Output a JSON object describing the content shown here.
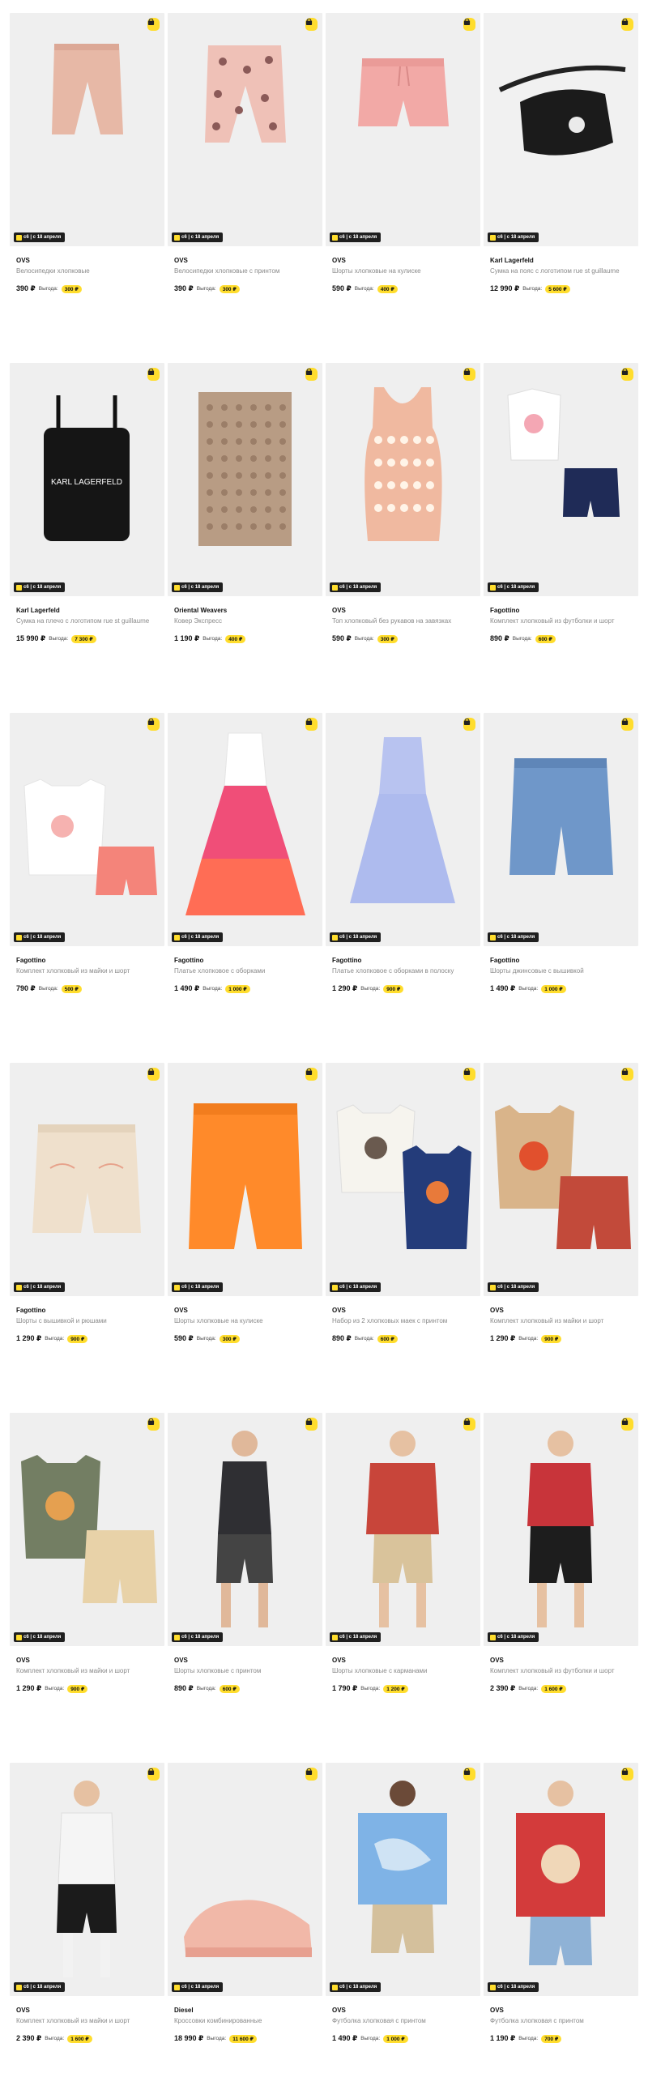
{
  "badge_text": "c6 | c 18 апреля",
  "save_label": "Выгода:",
  "products": [
    {
      "brand": "OVS",
      "title": "Велосипедки хлопковые",
      "price": "390 ₽",
      "save": "300 ₽",
      "bg": "#efefef",
      "art": "bike-shorts-pink"
    },
    {
      "brand": "OVS",
      "title": "Велосипедки хлопковые с принтом",
      "price": "390 ₽",
      "save": "300 ₽",
      "bg": "#efefef",
      "art": "bike-shorts-floral"
    },
    {
      "brand": "OVS",
      "title": "Шорты хлопковые на кулиске",
      "price": "590 ₽",
      "save": "400 ₽",
      "bg": "#efefef",
      "art": "shorts-pink"
    },
    {
      "brand": "Karl Lagerfeld",
      "title": "Сумка на пояс с логотипом rue st guillaume",
      "price": "12 990 ₽",
      "save": "5 600 ₽",
      "bg": "#f1f1f1",
      "art": "waist-bag"
    },
    {
      "brand": "Karl Lagerfeld",
      "title": "Сумка на плечо с логотипом rue st guillaume",
      "price": "15 990 ₽",
      "save": "7 300 ₽",
      "bg": "#efefef",
      "art": "shoulder-bag"
    },
    {
      "brand": "Oriental Weavers",
      "title": "Ковер Экспресс",
      "price": "1 190 ₽",
      "save": "400 ₽",
      "bg": "#efefef",
      "art": "rug"
    },
    {
      "brand": "OVS",
      "title": "Топ хлопковый без рукавов на завязках",
      "price": "590 ₽",
      "save": "300 ₽",
      "bg": "#efefef",
      "art": "top-floral"
    },
    {
      "brand": "Fagottino",
      "title": "Комплект хлопковый из футболки и шорт",
      "price": "890 ₽",
      "save": "600 ₽",
      "bg": "#efefef",
      "art": "set-white-navy"
    },
    {
      "brand": "Fagottino",
      "title": "Комплект хлопковый из майки и шорт",
      "price": "790 ₽",
      "save": "500 ₽",
      "bg": "#efefef",
      "art": "set-white-coral"
    },
    {
      "brand": "Fagottino",
      "title": "Платье хлопковое с оборками",
      "price": "1 490 ₽",
      "save": "1 000 ₽",
      "bg": "#efefef",
      "art": "dress-pink"
    },
    {
      "brand": "Fagottino",
      "title": "Платье хлопковое с оборками в полоску",
      "price": "1 290 ₽",
      "save": "900 ₽",
      "bg": "#efefef",
      "art": "dress-blue"
    },
    {
      "brand": "Fagottino",
      "title": "Шорты джинсовые с вышивкой",
      "price": "1 490 ₽",
      "save": "1 000 ₽",
      "bg": "#efefef",
      "art": "denim-shorts"
    },
    {
      "brand": "Fagottino",
      "title": "Шорты с вышивкой и рюшами",
      "price": "1 290 ₽",
      "save": "900 ₽",
      "bg": "#efefef",
      "art": "shorts-beige"
    },
    {
      "brand": "OVS",
      "title": "Шорты хлопковые на кулиске",
      "price": "590 ₽",
      "save": "300 ₽",
      "bg": "#efefef",
      "art": "shorts-orange"
    },
    {
      "brand": "OVS",
      "title": "Набор из 2 хлопковых маек с принтом",
      "price": "890 ₽",
      "save": "600 ₽",
      "bg": "#efefef",
      "art": "tank-set"
    },
    {
      "brand": "OVS",
      "title": "Комплект хлопковый из майки и шорт",
      "price": "1 290 ₽",
      "save": "900 ₽",
      "bg": "#efefef",
      "art": "set-tan-red"
    },
    {
      "brand": "OVS",
      "title": "Комплект хлопковый из майки и шорт",
      "price": "1 290 ₽",
      "save": "900 ₽",
      "bg": "#efefef",
      "art": "set-green-beige"
    },
    {
      "brand": "OVS",
      "title": "Шорты хлопковые с принтом",
      "price": "890 ₽",
      "save": "600 ₽",
      "bg": "#efefef",
      "art": "boy-vest"
    },
    {
      "brand": "OVS",
      "title": "Шорты хлопковые с карманами",
      "price": "1 790 ₽",
      "save": "1 200 ₽",
      "bg": "#efefef",
      "art": "boy-red-beige"
    },
    {
      "brand": "OVS",
      "title": "Комплект хлопковый из футболки и шорт",
      "price": "2 390 ₽",
      "save": "1 600 ₽",
      "bg": "#efefef",
      "art": "boy-red-black"
    },
    {
      "brand": "OVS",
      "title": "Комплект хлопковый из майки и шорт",
      "price": "2 390 ₽",
      "save": "1 600 ₽",
      "bg": "#efefef",
      "art": "boy-white-black"
    },
    {
      "brand": "Diesel",
      "title": "Кроссовки комбинированные",
      "price": "18 990 ₽",
      "save": "11 600 ₽",
      "bg": "#efefef",
      "art": "sneakers"
    },
    {
      "brand": "OVS",
      "title": "Футболка хлопковая с принтом",
      "price": "1 490 ₽",
      "save": "1 000 ₽",
      "bg": "#efefef",
      "art": "boy-tiedye"
    },
    {
      "brand": "OVS",
      "title": "Футболка хлопковая с принтом",
      "price": "1 190 ₽",
      "save": "700 ₽",
      "bg": "#efefef",
      "art": "boy-red-tee"
    }
  ]
}
